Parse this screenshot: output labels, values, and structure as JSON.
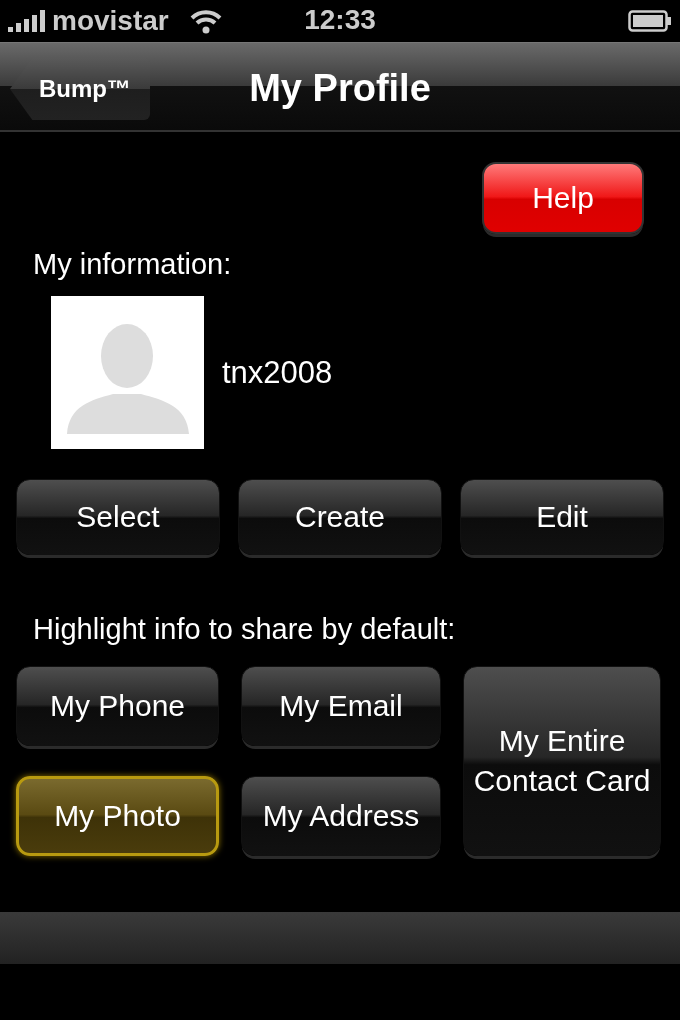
{
  "status_bar": {
    "carrier": "movistar",
    "time": "12:33"
  },
  "nav_bar": {
    "back_button": "Bump™",
    "title": "My Profile"
  },
  "help_button": "Help",
  "my_information": {
    "heading": "My information:",
    "username": "tnx2008"
  },
  "photo_actions": [
    "Select",
    "Create",
    "Edit"
  ],
  "share": {
    "heading": "Highlight info to share by default:",
    "options": [
      {
        "label": "My Phone",
        "selected": false
      },
      {
        "label": "My Email",
        "selected": false
      },
      {
        "label": "My Entire Contact Card",
        "selected": false
      },
      {
        "label": "My Photo",
        "selected": true
      },
      {
        "label": "My Address",
        "selected": false
      }
    ]
  }
}
